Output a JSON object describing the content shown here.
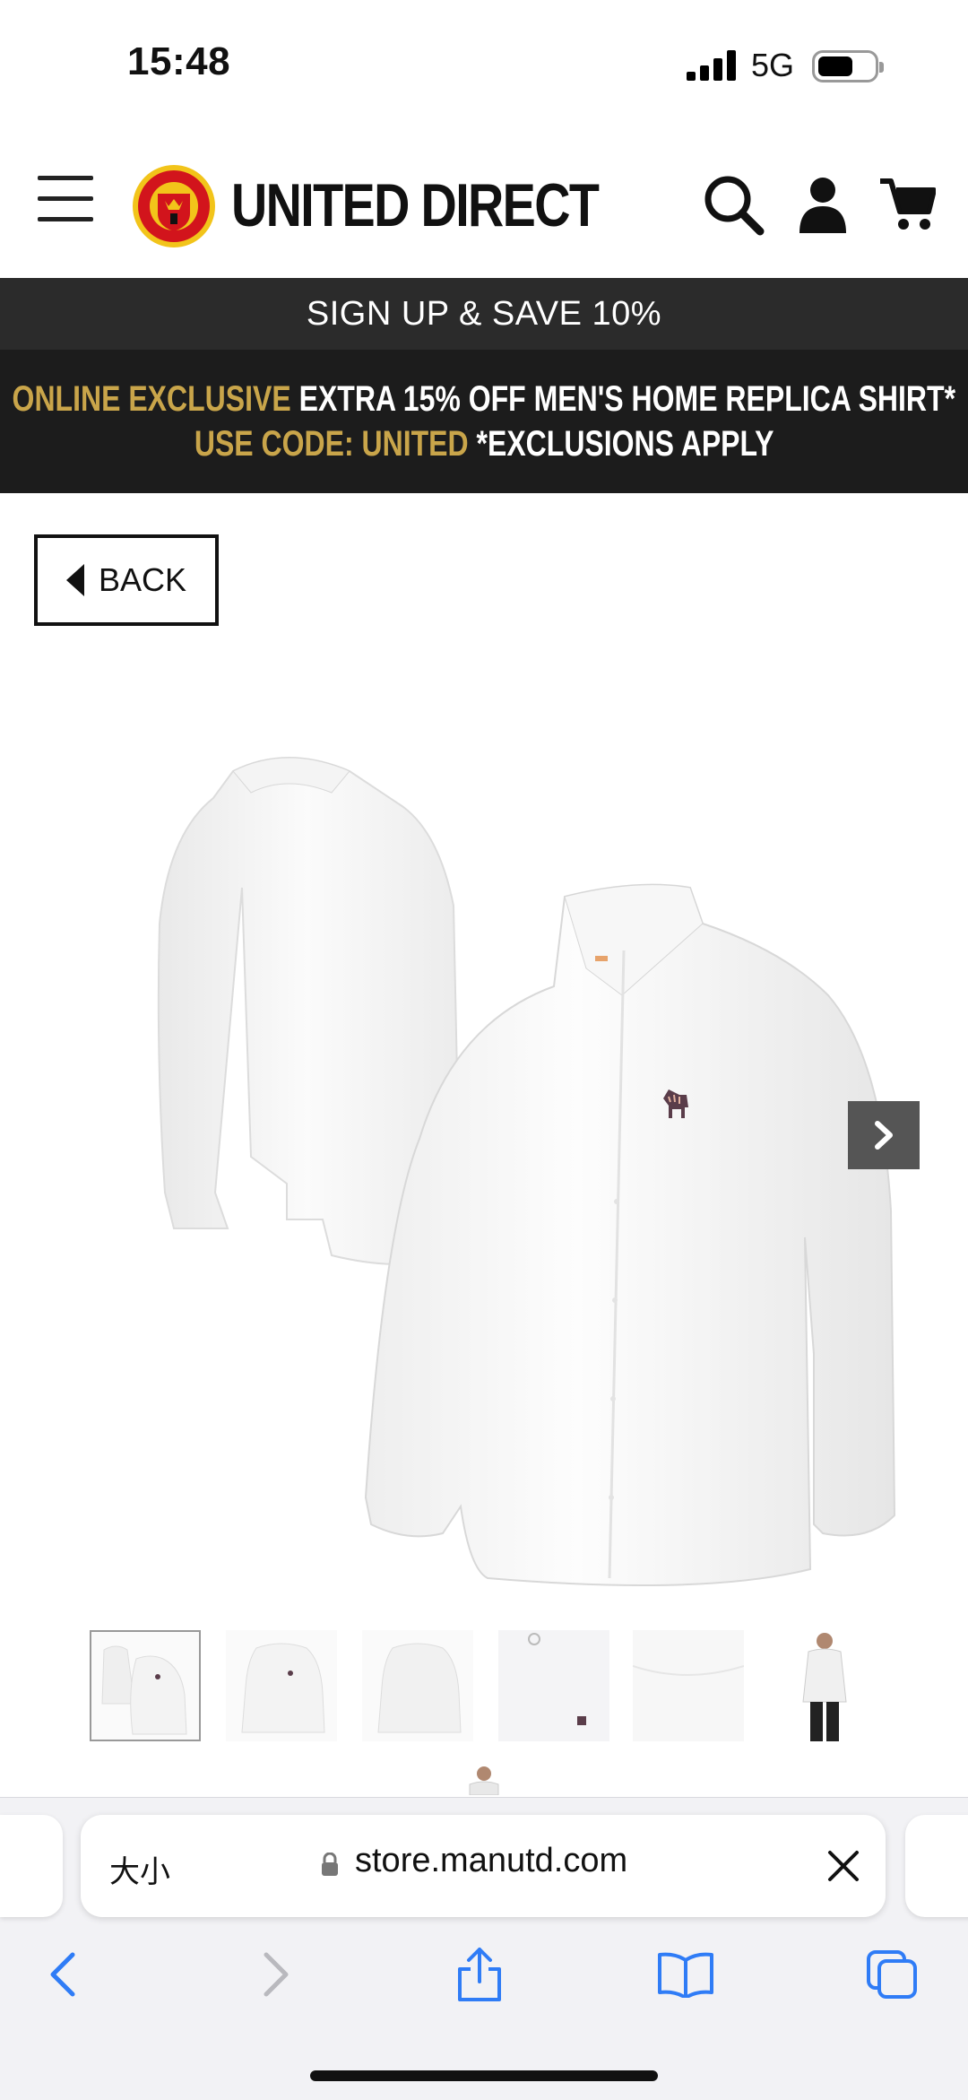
{
  "status_bar": {
    "time": "15:48",
    "network": "5G"
  },
  "header": {
    "brand": "UNITED DIRECT",
    "icons": [
      "menu-icon",
      "club-crest-logo",
      "search-icon",
      "account-icon",
      "cart-icon"
    ]
  },
  "promo": {
    "signup": "SIGN UP & SAVE 10%",
    "line1_gold": "ONLINE EXCLUSIVE",
    "line1_white": " EXTRA 15% OFF MEN'S HOME REPLICA SHIRT*",
    "line2_gold": "USE CODE: UNITED",
    "line2_white": " *EXCLUSIONS APPLY",
    "colors": {
      "gold": "#c9a54a",
      "bar": "#1c1c1c",
      "signup_bar": "#2b2b2b"
    }
  },
  "back_button": {
    "label": "BACK"
  },
  "product": {
    "image": "white-long-sleeve-shirt",
    "thumbnail_count": 7,
    "selected_thumbnail": 1
  },
  "browser": {
    "text_size_label": "大小",
    "url": "store.manutd.com",
    "toolbar_icons": [
      "back-icon",
      "forward-icon",
      "share-icon",
      "bookmarks-icon",
      "tabs-icon"
    ]
  }
}
